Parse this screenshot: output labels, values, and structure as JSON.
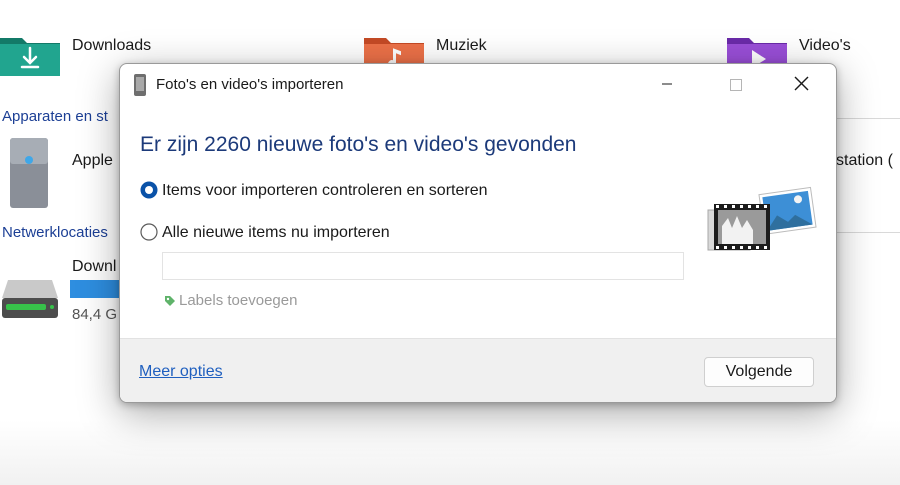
{
  "explorer": {
    "folders": [
      {
        "label": "Downloads",
        "icon": "download-folder-icon",
        "color": "#1f9e8a"
      },
      {
        "label": "Muziek",
        "icon": "music-folder-icon",
        "color": "#e8623a"
      },
      {
        "label": "Video's",
        "icon": "video-folder-icon",
        "color": "#8a3fc8"
      }
    ],
    "devices_header": "Apparaten en st",
    "device_label": "Apple",
    "device_right_label": "station (",
    "network_header": "Netwerklocaties",
    "drive_label": "Downl",
    "drive_size": "84,4 G",
    "drive_fill": 1.0
  },
  "dialog": {
    "title": "Foto's en video's importeren",
    "headline": "Er zijn 2260 nieuwe foto's en video's gevonden",
    "options": [
      {
        "label": "Items voor importeren controleren en sorteren",
        "selected": true
      },
      {
        "label": "Alle nieuwe items nu importeren",
        "selected": false
      }
    ],
    "labels_input_value": "",
    "add_labels_text": "Labels toevoegen",
    "more_options": "Meer opties",
    "next_button": "Volgende"
  },
  "colors": {
    "accent": "#1f5fbf",
    "headline": "#1c3a7a",
    "radio_selected": "#0a52a8"
  }
}
